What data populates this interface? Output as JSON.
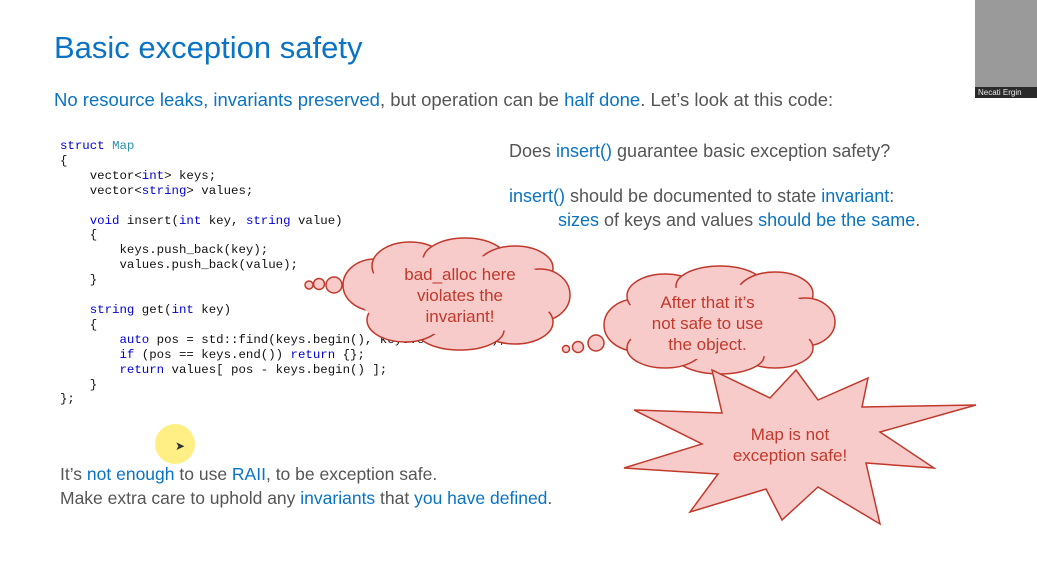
{
  "slide": {
    "title": "Basic exception safety",
    "subtitle": {
      "p1": "No resource leaks, ",
      "p2": "invariants preserved",
      "p3": ", but operation can be ",
      "p4": "half done",
      "p5": ". Let’s look at this code:"
    },
    "code_lines": [
      "struct Map",
      "{",
      "    vector<int> keys;",
      "    vector<string> values;",
      "",
      "    void insert(int key, string value)",
      "    {",
      "        keys.push_back(key);",
      "        values.push_back(value);",
      "    }",
      "",
      "    string get(int key)",
      "    {",
      "        auto pos = std::find(keys.begin(), keys.end(), key);",
      "        if (pos == keys.end()) return {};",
      "        return values[ pos - keys.begin() ];",
      "    }",
      "};"
    ],
    "question": {
      "p1": "Does ",
      "p2": "insert()",
      "p3": " guarantee basic exception safety?"
    },
    "invariant_line1": {
      "p1": "insert()",
      "p2": " should be documented to state ",
      "p3": "invariant",
      "p4": ":"
    },
    "invariant_line2": {
      "p1": "sizes",
      "p2": " of keys and values ",
      "p3": "should be the same",
      "p4": "."
    },
    "bubble1": [
      "bad_alloc here",
      "violates the",
      "invariant!"
    ],
    "bubble2": [
      "After that it’s",
      "not safe to use",
      "the object."
    ],
    "starburst": [
      "Map is not",
      "exception safe!"
    ],
    "bottom1": {
      "p1": "It’s ",
      "p2": "not enough",
      "p3": " to use ",
      "p4": "RAII",
      "p5": ", to be exception safe."
    },
    "bottom2": {
      "p1": "Make extra care to uphold any ",
      "p2": "invariants",
      "p3": " that ",
      "p4": "you have defined",
      "p5": "."
    }
  },
  "webcam": {
    "name": "Necati Ergin"
  },
  "colors": {
    "accent": "#0a73c4",
    "callout_fill": "#f8cbcb",
    "callout_stroke": "#c0392b"
  }
}
